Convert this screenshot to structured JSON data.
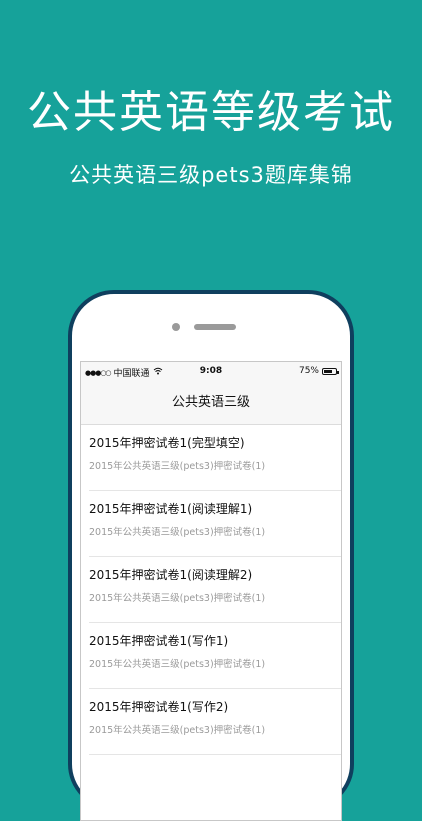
{
  "hero": {
    "title": "公共英语等级考试",
    "subtitle": "公共英语三级pets3题库集锦"
  },
  "status_bar": {
    "carrier": "中国联通",
    "time": "9:08",
    "battery_percent": "75%",
    "battery_level": 0.75,
    "signal_dots": "●●●○○"
  },
  "nav": {
    "title": "公共英语三级"
  },
  "list": {
    "items": [
      {
        "title": "2015年押密试卷1(完型填空)",
        "subtitle": "2015年公共英语三级(pets3)押密试卷(1)"
      },
      {
        "title": "2015年押密试卷1(阅读理解1)",
        "subtitle": "2015年公共英语三级(pets3)押密试卷(1)"
      },
      {
        "title": "2015年押密试卷1(阅读理解2)",
        "subtitle": "2015年公共英语三级(pets3)押密试卷(1)"
      },
      {
        "title": "2015年押密试卷1(写作1)",
        "subtitle": "2015年公共英语三级(pets3)押密试卷(1)"
      },
      {
        "title": "2015年押密试卷1(写作2)",
        "subtitle": "2015年公共英语三级(pets3)押密试卷(1)"
      }
    ]
  }
}
